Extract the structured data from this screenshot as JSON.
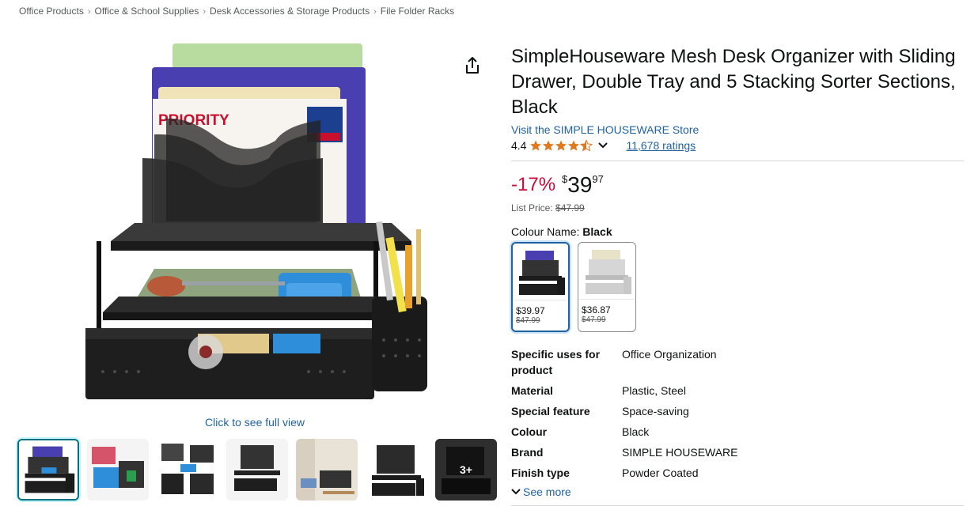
{
  "breadcrumb": [
    "Office Products",
    "Office & School Supplies",
    "Desk Accessories & Storage Products",
    "File Folder Racks"
  ],
  "breadcrumb_sep": "›",
  "image": {
    "see_full_view": "Click to see full view",
    "thumbs_more_label": "3+"
  },
  "product": {
    "title": "SimpleHouseware Mesh Desk Organizer with Sliding Drawer, Double Tray and 5 Stacking Sorter Sections, Black",
    "store_link": "Visit the SIMPLE HOUSEWARE Store",
    "rating": "4.4",
    "rating_value": 4.4,
    "ratings_count": "11,678 ratings",
    "discount": "-17%",
    "price_currency": "$",
    "price_whole": "39",
    "price_fraction": "97",
    "list_price_label": "List Price:",
    "list_price": "$47.99",
    "colour_label": "Colour Name:",
    "colour_value": "Black",
    "swatches": [
      {
        "price": "$39.97",
        "list_price": "$47.99"
      },
      {
        "price": "$36.87",
        "list_price": "$47.99"
      }
    ],
    "specs": [
      {
        "key": "Specific uses for product",
        "value": "Office Organization"
      },
      {
        "key": "Material",
        "value": "Plastic, Steel"
      },
      {
        "key": "Special feature",
        "value": "Space-saving"
      },
      {
        "key": "Colour",
        "value": "Black"
      },
      {
        "key": "Brand",
        "value": "SIMPLE HOUSEWARE"
      },
      {
        "key": "Finish type",
        "value": "Powder Coated"
      }
    ],
    "see_more": "See more"
  },
  "colors": {
    "link": "#2162a1",
    "discount": "#cc0c39",
    "star": "#de7921",
    "selected_thumb": "#007185"
  }
}
